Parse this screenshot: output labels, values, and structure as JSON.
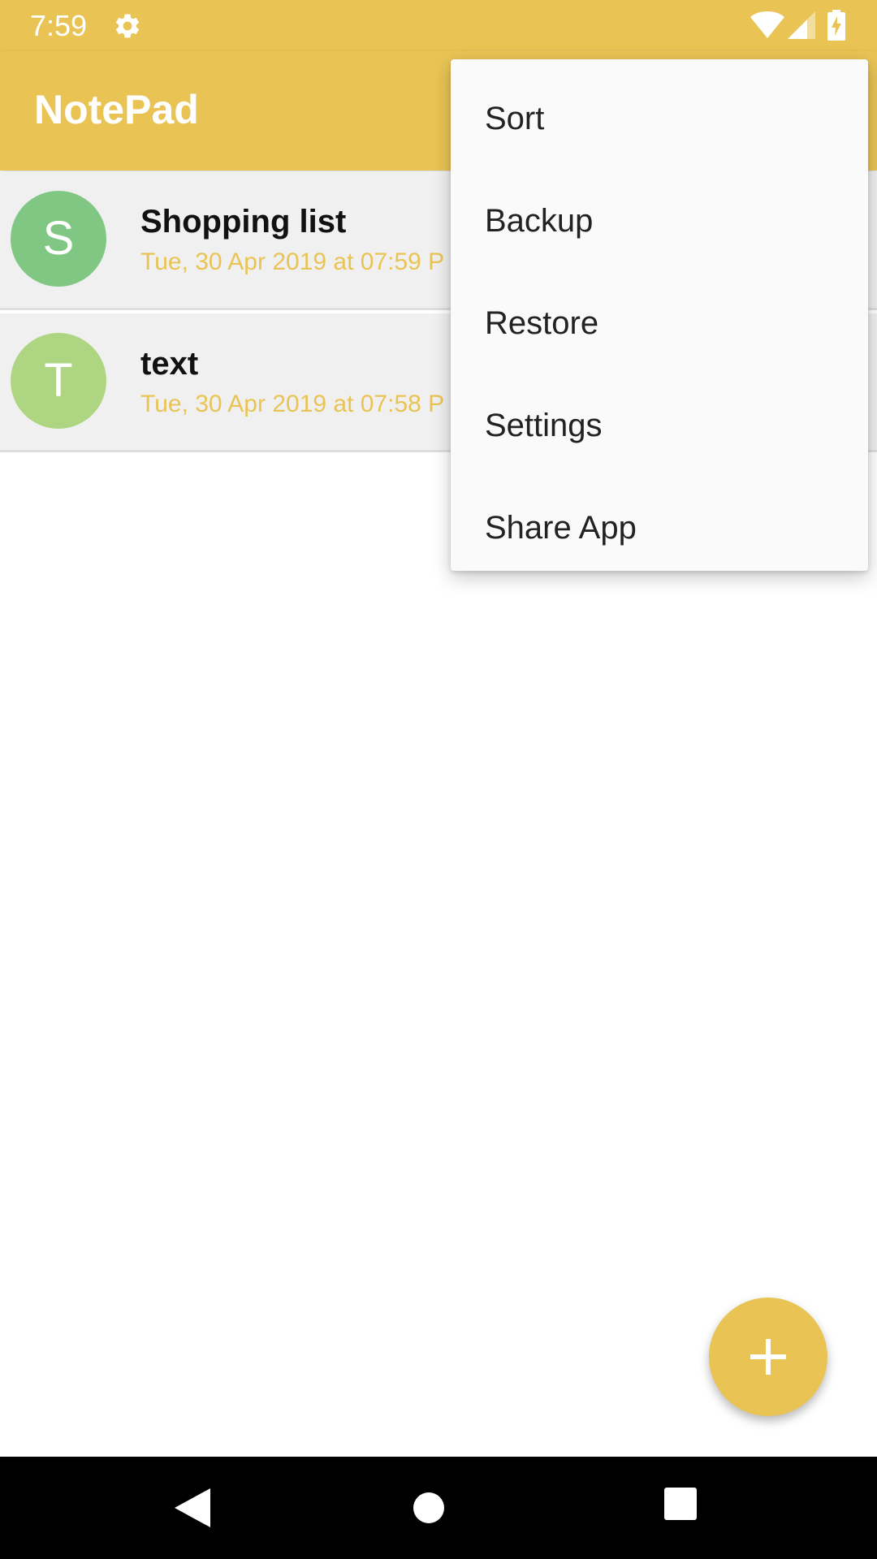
{
  "status_bar": {
    "time": "7:59",
    "icons": [
      "gear-icon",
      "wifi-icon",
      "signal-icon",
      "battery-charging-icon"
    ]
  },
  "app_bar": {
    "title": "NotePad"
  },
  "notes": [
    {
      "initial": "S",
      "title": "Shopping list",
      "date": "Tue, 30 Apr 2019 at 07:59 P",
      "avatar_color": "#81c784"
    },
    {
      "initial": "T",
      "title": "text",
      "date": "Tue, 30 Apr 2019 at 07:58 P",
      "avatar_color": "#aed581"
    }
  ],
  "overflow_menu": {
    "items": [
      "Sort",
      "Backup",
      "Restore",
      "Settings",
      "Share App"
    ]
  },
  "fab": {
    "icon": "plus-icon"
  },
  "navigation_bar": {
    "icons": [
      "back-icon",
      "home-icon",
      "recents-icon"
    ]
  },
  "colors": {
    "primary": "#e9c455",
    "row_background": "#f0f0f0",
    "menu_background": "#fafafa"
  }
}
